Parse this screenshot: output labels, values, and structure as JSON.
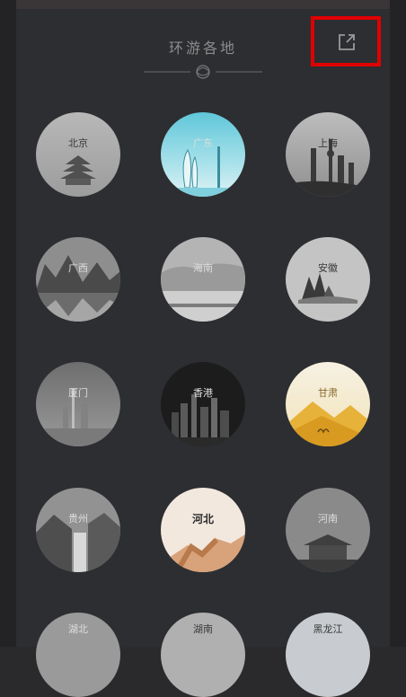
{
  "header": {
    "title": "环游各地"
  },
  "share_icon": "share-export-icon",
  "highlight_color": "#e10000",
  "regions": [
    {
      "id": "beijing",
      "label": "北京"
    },
    {
      "id": "guangdong",
      "label": "广东"
    },
    {
      "id": "shanghai",
      "label": "上海"
    },
    {
      "id": "guangxi",
      "label": "广西"
    },
    {
      "id": "hainan",
      "label": "海南"
    },
    {
      "id": "anhui",
      "label": "安徽"
    },
    {
      "id": "xiamen",
      "label": "厦门"
    },
    {
      "id": "hongkong",
      "label": "香港"
    },
    {
      "id": "gansu",
      "label": "甘肃"
    },
    {
      "id": "guizhou",
      "label": "贵州"
    },
    {
      "id": "hebei",
      "label": "河北"
    },
    {
      "id": "henan",
      "label": "河南"
    },
    {
      "id": "hubei",
      "label": "湖北"
    },
    {
      "id": "hunan",
      "label": "湖南"
    },
    {
      "id": "heilongjiang",
      "label": "黑龙江"
    }
  ]
}
